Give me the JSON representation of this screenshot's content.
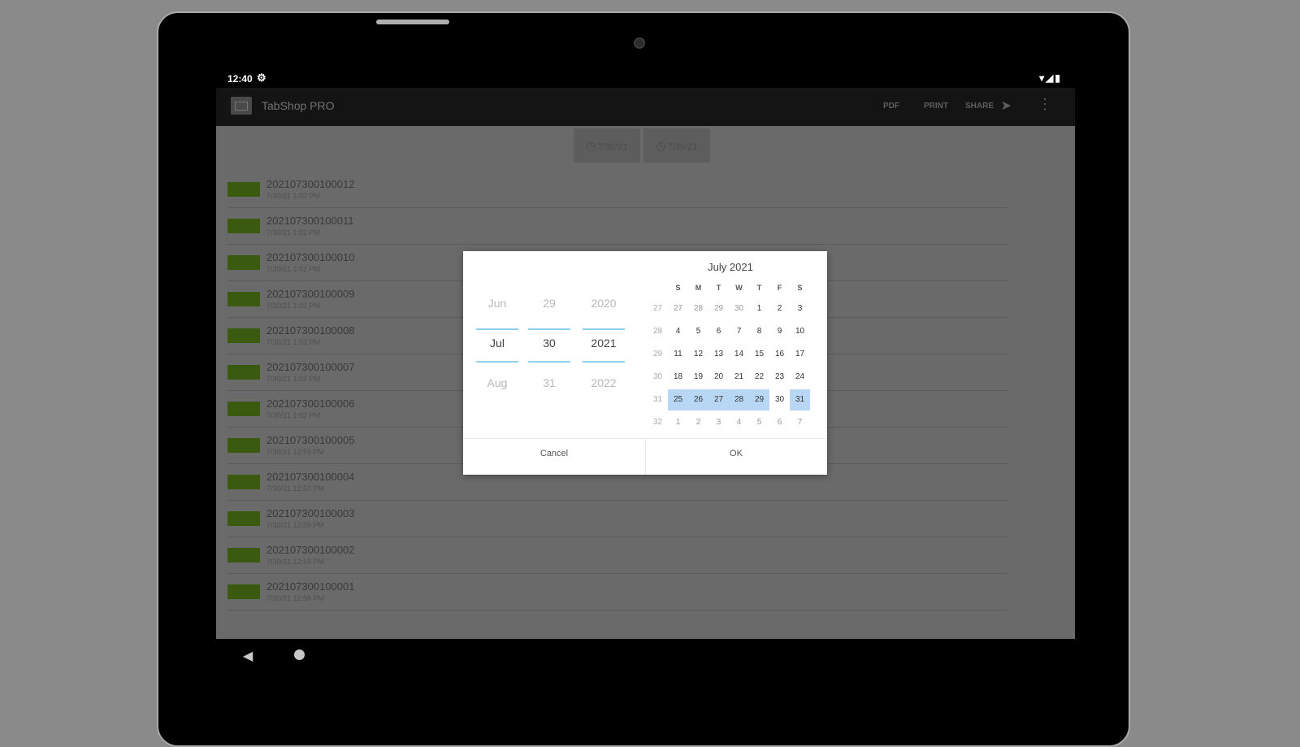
{
  "status": {
    "time": "12:40",
    "icons_right": "▾◢▮"
  },
  "appbar": {
    "title": "TabShop PRO",
    "actions": [
      "PDF",
      "PRINT",
      "SHARE"
    ]
  },
  "filters": [
    {
      "label": "7/30/21"
    },
    {
      "label": "7/30/21"
    }
  ],
  "list": [
    {
      "num": "202107300100012",
      "date": "7/30/21 1:02 PM"
    },
    {
      "num": "202107300100011",
      "date": "7/30/21 1:02 PM"
    },
    {
      "num": "202107300100010",
      "date": "7/30/21 1:02 PM"
    },
    {
      "num": "202107300100009",
      "date": "7/30/21 1:02 PM"
    },
    {
      "num": "202107300100008",
      "date": "7/30/21 1:02 PM"
    },
    {
      "num": "202107300100007",
      "date": "7/30/21 1:02 PM"
    },
    {
      "num": "202107300100006",
      "date": "7/30/21 1:02 PM"
    },
    {
      "num": "202107300100005",
      "date": "7/30/21 12:59 PM"
    },
    {
      "num": "202107300100004",
      "date": "7/30/21 12:59 PM"
    },
    {
      "num": "202107300100003",
      "date": "7/30/21 12:59 PM"
    },
    {
      "num": "202107300100002",
      "date": "7/30/21 12:59 PM"
    },
    {
      "num": "202107300100001",
      "date": "7/30/21 12:59 PM"
    }
  ],
  "dialog": {
    "spinners": {
      "month": {
        "prev": "Jun",
        "sel": "Jul",
        "next": "Aug"
      },
      "day": {
        "prev": "29",
        "sel": "30",
        "next": "31"
      },
      "year": {
        "prev": "2020",
        "sel": "2021",
        "next": "2022"
      }
    },
    "calendar": {
      "title": "July 2021",
      "weekdays": [
        "S",
        "M",
        "T",
        "W",
        "T",
        "F",
        "S"
      ],
      "weeks": [
        {
          "wk": "27",
          "days": [
            "27",
            "28",
            "29",
            "30",
            "1",
            "2",
            "3"
          ]
        },
        {
          "wk": "28",
          "days": [
            "4",
            "5",
            "6",
            "7",
            "8",
            "9",
            "10"
          ]
        },
        {
          "wk": "29",
          "days": [
            "11",
            "12",
            "13",
            "14",
            "15",
            "16",
            "17"
          ]
        },
        {
          "wk": "30",
          "days": [
            "18",
            "19",
            "20",
            "21",
            "22",
            "23",
            "24"
          ]
        },
        {
          "wk": "31",
          "days": [
            "25",
            "26",
            "27",
            "28",
            "29",
            "30",
            "31"
          ]
        },
        {
          "wk": "32",
          "days": [
            "1",
            "2",
            "3",
            "4",
            "5",
            "6",
            "7"
          ]
        }
      ]
    },
    "cancel": "Cancel",
    "ok": "OK"
  }
}
